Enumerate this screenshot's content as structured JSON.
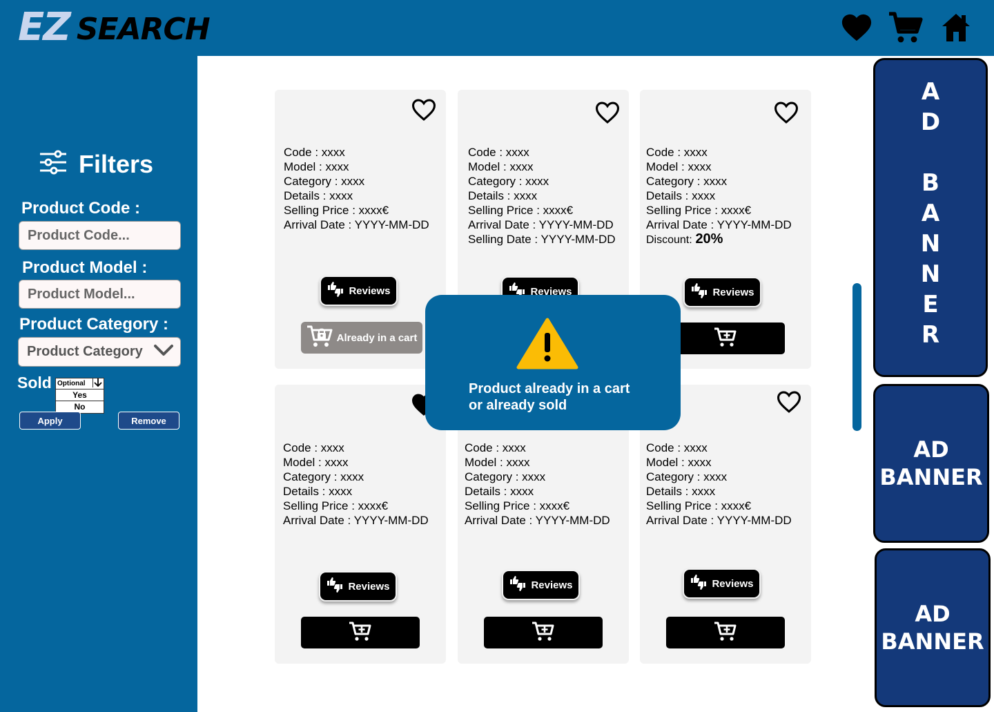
{
  "header": {
    "logo_ez": "EZ",
    "logo_search": "SEARCH",
    "icons": [
      "heart-icon",
      "cart-icon",
      "home-icon"
    ]
  },
  "filters": {
    "title": "Filters",
    "code_label": "Product Code :",
    "code_placeholder": "Product Code...",
    "model_label": "Product Model :",
    "model_placeholder": "Product Model...",
    "category_label": "Product Category :",
    "category_value": "Product Category",
    "sold_label": "Sold",
    "sold_options": [
      "Optional",
      "Yes",
      "No"
    ],
    "apply": "Apply",
    "remove": "Remove"
  },
  "products": [
    {
      "lines": [
        "Code : xxxx",
        "Model : xxxx",
        "Category : xxxx",
        "Details : xxxx",
        "Selling Price : xxxx€",
        "Arrival Date : YYYY-MM-DD"
      ],
      "reviews": "Reviews",
      "cart_label": "Already in a cart",
      "favorited": false
    },
    {
      "lines": [
        "Code : xxxx",
        "Model : xxxx",
        "Category : xxxx",
        "Details : xxxx",
        "Selling Price : xxxx€",
        "Arrival Date : YYYY-MM-DD",
        "Selling Date : YYYY-MM-DD"
      ],
      "reviews": "Reviews",
      "favorited": false
    },
    {
      "lines": [
        "Code : xxxx",
        "Model : xxxx",
        "Category : xxxx",
        "Details : xxxx",
        "Selling Price : xxxx€",
        "Arrival Date : YYYY-MM-DD"
      ],
      "discount_label": "Discount:",
      "discount_value": "20%",
      "reviews": "Reviews",
      "favorited": false
    },
    {
      "lines": [
        "Code : xxxx",
        "Model : xxxx",
        "Category : xxxx",
        "Details : xxxx",
        "Selling Price : xxxx€",
        "Arrival Date : YYYY-MM-DD"
      ],
      "reviews": "Reviews",
      "favorited": true
    },
    {
      "lines": [
        "Code : xxxx",
        "Model : xxxx",
        "Category : xxxx",
        "Details : xxxx",
        "Selling Price : xxxx€",
        "Arrival Date : YYYY-MM-DD"
      ],
      "reviews": "Reviews",
      "favorited": false
    },
    {
      "lines": [
        "Code : xxxx",
        "Model : xxxx",
        "Category : xxxx",
        "Details : xxxx",
        "Selling Price : xxxx€",
        "Arrival Date : YYYY-MM-DD"
      ],
      "reviews": "Reviews",
      "favorited": false
    }
  ],
  "modal": {
    "line1": "Product already in a cart",
    "line2": "or already sold",
    "icon": "warning-icon"
  },
  "ads": {
    "vertical_letters": [
      "A",
      "D",
      "",
      "B",
      "A",
      "N",
      "N",
      "E",
      "R"
    ],
    "banner2_line1": "AD",
    "banner2_line2": "BANNER",
    "banner3_line1": "AD",
    "banner3_line2": "BANNER"
  },
  "colors": {
    "primary": "#05669e",
    "ad_bg": "#14397a",
    "card_bg": "#f3f3f3",
    "warning": "#fbbc05"
  }
}
